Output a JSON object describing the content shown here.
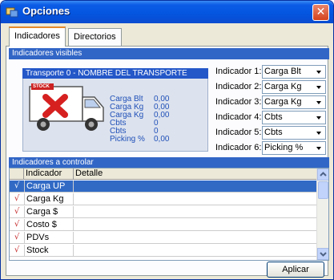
{
  "window": {
    "title": "Opciones"
  },
  "tabs": [
    {
      "label": "Indicadores",
      "active": true
    },
    {
      "label": "Directorios",
      "active": false
    }
  ],
  "visible_section": {
    "header": "Indicadores visibles",
    "transport_title": "Transporte   0 - NOMBRE DEL TRANSPORTE",
    "stock_badge": "STOCK",
    "metrics": [
      {
        "label": "Carga Blt",
        "value": "0,00"
      },
      {
        "label": "Carga Kg",
        "value": "0,00"
      },
      {
        "label": "Carga Kg",
        "value": "0,00"
      },
      {
        "label": "Cbts",
        "value": "0"
      },
      {
        "label": "Cbts",
        "value": "0"
      },
      {
        "label": "Picking %",
        "value": "0,00"
      }
    ],
    "indicators": [
      {
        "label": "Indicador 1:",
        "value": "Carga Blt"
      },
      {
        "label": "Indicador 2:",
        "value": "Carga Kg"
      },
      {
        "label": "Indicador 3:",
        "value": "Carga Kg"
      },
      {
        "label": "Indicador 4:",
        "value": "Cbts"
      },
      {
        "label": "Indicador 5:",
        "value": "Cbts"
      },
      {
        "label": "Indicador 6:",
        "value": "Picking %"
      }
    ]
  },
  "control_section": {
    "header": "Indicadores a controlar",
    "columns": {
      "indicador": "Indicador",
      "detalle": "Detalle"
    },
    "rows": [
      {
        "check": "√",
        "indicador": "Carga UP",
        "selected": true
      },
      {
        "check": "√",
        "indicador": "Carga Kg",
        "selected": false
      },
      {
        "check": "√",
        "indicador": "Carga $",
        "selected": false
      },
      {
        "check": "√",
        "indicador": "Costo $",
        "selected": false
      },
      {
        "check": "√",
        "indicador": "PDVs",
        "selected": false
      },
      {
        "check": "√",
        "indicador": "Stock",
        "selected": false
      }
    ]
  },
  "footer": {
    "apply_label": "Aplicar"
  },
  "colors": {
    "title_bar": "#0455e0",
    "section_header": "#3266c6",
    "selection": "#316ac5",
    "check": "#c62828"
  }
}
